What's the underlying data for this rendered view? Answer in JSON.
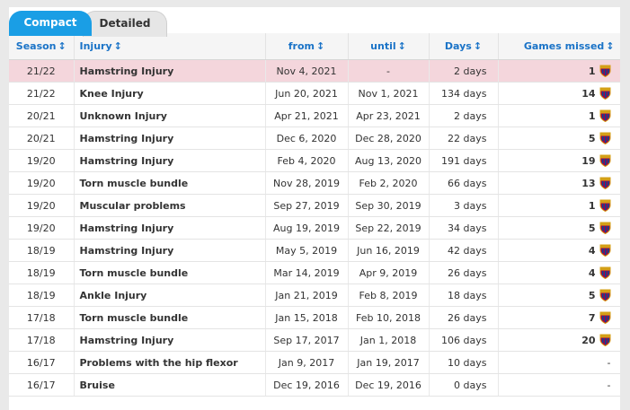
{
  "tabs": {
    "compact": "Compact",
    "detailed": "Detailed"
  },
  "headers": {
    "season": "Season",
    "injury": "Injury",
    "from": "from",
    "until": "until",
    "days": "Days",
    "games": "Games missed",
    "sort_icon": "↕"
  },
  "colors": {
    "accent": "#1a73c7",
    "tab_active": "#1a9ee5",
    "highlight_row": "#f4d6dc"
  },
  "rows": [
    {
      "season": "21/22",
      "injury": "Hamstring Injury",
      "from": "Nov 4, 2021",
      "until": "-",
      "days": "2 days",
      "games": "1",
      "crest": true,
      "highlight": true
    },
    {
      "season": "21/22",
      "injury": "Knee Injury",
      "from": "Jun 20, 2021",
      "until": "Nov 1, 2021",
      "days": "134 days",
      "games": "14",
      "crest": true
    },
    {
      "season": "20/21",
      "injury": "Unknown Injury",
      "from": "Apr 21, 2021",
      "until": "Apr 23, 2021",
      "days": "2 days",
      "games": "1",
      "crest": true
    },
    {
      "season": "20/21",
      "injury": "Hamstring Injury",
      "from": "Dec 6, 2020",
      "until": "Dec 28, 2020",
      "days": "22 days",
      "games": "5",
      "crest": true
    },
    {
      "season": "19/20",
      "injury": "Hamstring Injury",
      "from": "Feb 4, 2020",
      "until": "Aug 13, 2020",
      "days": "191 days",
      "games": "19",
      "crest": true
    },
    {
      "season": "19/20",
      "injury": "Torn muscle bundle",
      "from": "Nov 28, 2019",
      "until": "Feb 2, 2020",
      "days": "66 days",
      "games": "13",
      "crest": true
    },
    {
      "season": "19/20",
      "injury": "Muscular problems",
      "from": "Sep 27, 2019",
      "until": "Sep 30, 2019",
      "days": "3 days",
      "games": "1",
      "crest": true
    },
    {
      "season": "19/20",
      "injury": "Hamstring Injury",
      "from": "Aug 19, 2019",
      "until": "Sep 22, 2019",
      "days": "34 days",
      "games": "5",
      "crest": true
    },
    {
      "season": "18/19",
      "injury": "Hamstring Injury",
      "from": "May 5, 2019",
      "until": "Jun 16, 2019",
      "days": "42 days",
      "games": "4",
      "crest": true
    },
    {
      "season": "18/19",
      "injury": "Torn muscle bundle",
      "from": "Mar 14, 2019",
      "until": "Apr 9, 2019",
      "days": "26 days",
      "games": "4",
      "crest": true
    },
    {
      "season": "18/19",
      "injury": "Ankle Injury",
      "from": "Jan 21, 2019",
      "until": "Feb 8, 2019",
      "days": "18 days",
      "games": "5",
      "crest": true
    },
    {
      "season": "17/18",
      "injury": "Torn muscle bundle",
      "from": "Jan 15, 2018",
      "until": "Feb 10, 2018",
      "days": "26 days",
      "games": "7",
      "crest": true
    },
    {
      "season": "17/18",
      "injury": "Hamstring Injury",
      "from": "Sep 17, 2017",
      "until": "Jan 1, 2018",
      "days": "106 days",
      "games": "20",
      "crest": true
    },
    {
      "season": "16/17",
      "injury": "Problems with the hip flexor",
      "from": "Jan 9, 2017",
      "until": "Jan 19, 2017",
      "days": "10 days",
      "games": "-",
      "crest": false
    },
    {
      "season": "16/17",
      "injury": "Bruise",
      "from": "Dec 19, 2016",
      "until": "Dec 19, 2016",
      "days": "0 days",
      "games": "-",
      "crest": false
    }
  ]
}
